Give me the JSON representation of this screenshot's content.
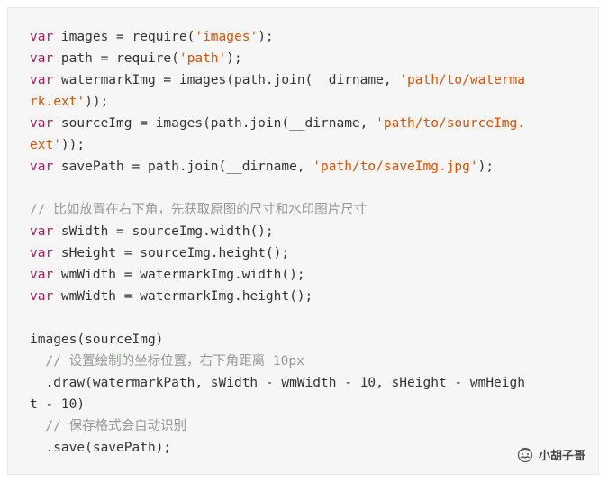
{
  "code": {
    "lines": [
      [
        {
          "t": "kw",
          "v": "var"
        },
        {
          "t": "plain",
          "v": " images = require("
        },
        {
          "t": "str",
          "v": "'images'"
        },
        {
          "t": "plain",
          "v": ");"
        }
      ],
      [
        {
          "t": "kw",
          "v": "var"
        },
        {
          "t": "plain",
          "v": " path = require("
        },
        {
          "t": "str",
          "v": "'path'"
        },
        {
          "t": "plain",
          "v": ");"
        }
      ],
      [
        {
          "t": "kw",
          "v": "var"
        },
        {
          "t": "plain",
          "v": " watermarkImg = images(path.join(__dirname, "
        },
        {
          "t": "str",
          "v": "'path/to/waterma"
        }
      ],
      [
        {
          "t": "str",
          "v": "rk.ext'"
        },
        {
          "t": "plain",
          "v": "));"
        }
      ],
      [
        {
          "t": "kw",
          "v": "var"
        },
        {
          "t": "plain",
          "v": " sourceImg = images(path.join(__dirname, "
        },
        {
          "t": "str",
          "v": "'path/to/sourceImg."
        }
      ],
      [
        {
          "t": "str",
          "v": "ext'"
        },
        {
          "t": "plain",
          "v": "));"
        }
      ],
      [
        {
          "t": "kw",
          "v": "var"
        },
        {
          "t": "plain",
          "v": " savePath = path.join(__dirname, "
        },
        {
          "t": "str",
          "v": "'path/to/saveImg.jpg'"
        },
        {
          "t": "plain",
          "v": ");"
        }
      ],
      [],
      [
        {
          "t": "cmt",
          "v": "// 比如放置在右下角，先获取原图的尺寸和水印图片尺寸"
        }
      ],
      [
        {
          "t": "kw",
          "v": "var"
        },
        {
          "t": "plain",
          "v": " sWidth = sourceImg.width();"
        }
      ],
      [
        {
          "t": "kw",
          "v": "var"
        },
        {
          "t": "plain",
          "v": " sHeight = sourceImg.height();"
        }
      ],
      [
        {
          "t": "kw",
          "v": "var"
        },
        {
          "t": "plain",
          "v": " wmWidth = watermarkImg.width();"
        }
      ],
      [
        {
          "t": "kw",
          "v": "var"
        },
        {
          "t": "plain",
          "v": " wmWidth = watermarkImg.height();"
        }
      ],
      [],
      [
        {
          "t": "plain",
          "v": "images(sourceImg)"
        }
      ],
      [
        {
          "t": "cmt",
          "v": "  // 设置绘制的坐标位置，右下角距离 10px"
        }
      ],
      [
        {
          "t": "plain",
          "v": "  .draw(watermarkPath, sWidth - wmWidth - 10, sHeight - wmHeigh"
        }
      ],
      [
        {
          "t": "plain",
          "v": "t - 10)"
        }
      ],
      [
        {
          "t": "cmt",
          "v": "  // 保存格式会自动识别"
        }
      ],
      [
        {
          "t": "plain",
          "v": "  .save(savePath);"
        }
      ]
    ]
  },
  "watermark": {
    "text": "小胡子哥",
    "icon": "mustache-face-icon"
  },
  "colors": {
    "background": "#f6f6f6",
    "keyword": "#a71d5d",
    "string": "#df5000",
    "comment": "#969896",
    "text": "#333333"
  }
}
